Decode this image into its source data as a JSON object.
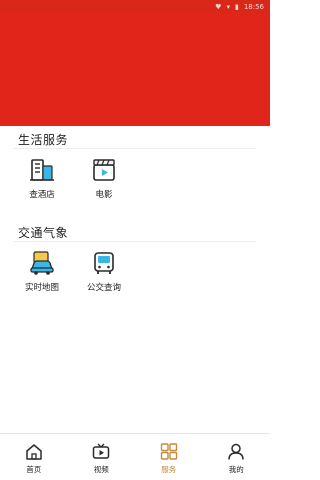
{
  "status_bar": {
    "time": "18:56",
    "icons": [
      "heart-icon",
      "signal-icon",
      "battery-icon"
    ]
  },
  "banner": {
    "color": "#e1251b"
  },
  "sections": [
    {
      "title": "生活服务",
      "items": [
        {
          "label": "查酒店",
          "icon": "hotel-building-icon"
        },
        {
          "label": "电影",
          "icon": "movie-clapper-icon"
        }
      ]
    },
    {
      "title": "交通气象",
      "items": [
        {
          "label": "实时地图",
          "icon": "car-map-icon"
        },
        {
          "label": "公交查询",
          "icon": "bus-icon"
        }
      ]
    }
  ],
  "tabbar": {
    "active": "服务",
    "active_color": "#c58a3c",
    "tabs": [
      {
        "label": "首页",
        "icon": "home-icon"
      },
      {
        "label": "视频",
        "icon": "tv-play-icon"
      },
      {
        "label": "服务",
        "icon": "grid-icon"
      },
      {
        "label": "我的",
        "icon": "person-icon"
      }
    ]
  }
}
